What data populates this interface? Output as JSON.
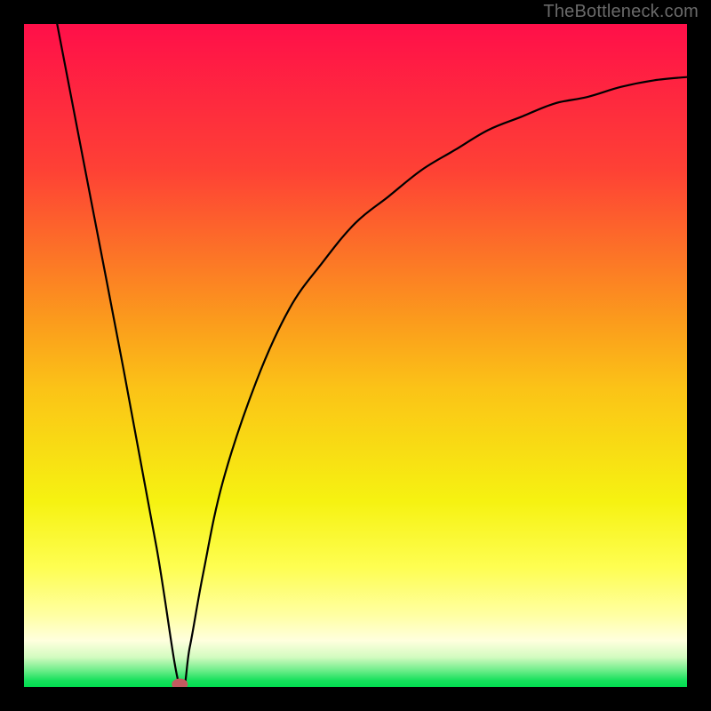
{
  "watermark": "TheBottleneck.com",
  "chart_data": {
    "type": "line",
    "title": "",
    "xlabel": "",
    "ylabel": "",
    "xlim": [
      0,
      100
    ],
    "ylim": [
      0,
      100
    ],
    "x": [
      5,
      10,
      15,
      20,
      23.5,
      25,
      27,
      30,
      35,
      40,
      45,
      50,
      55,
      60,
      65,
      70,
      75,
      80,
      85,
      90,
      95,
      100
    ],
    "values": [
      100,
      74,
      48,
      21,
      0,
      6,
      17,
      31,
      46,
      57,
      64,
      70,
      74,
      78,
      81,
      84,
      86,
      88,
      89,
      90.5,
      91.5,
      92
    ],
    "marker": {
      "x": 23.5,
      "y": 0
    },
    "background_gradient": {
      "stops": [
        {
          "offset": 0.0,
          "color": "#ff0f49"
        },
        {
          "offset": 0.22,
          "color": "#fe4135"
        },
        {
          "offset": 0.45,
          "color": "#fb9c1c"
        },
        {
          "offset": 0.55,
          "color": "#fbc317"
        },
        {
          "offset": 0.72,
          "color": "#f6f211"
        },
        {
          "offset": 0.82,
          "color": "#fefe52"
        },
        {
          "offset": 0.89,
          "color": "#ffffa1"
        },
        {
          "offset": 0.93,
          "color": "#ffffde"
        },
        {
          "offset": 0.955,
          "color": "#d3fbc0"
        },
        {
          "offset": 0.975,
          "color": "#6ded8a"
        },
        {
          "offset": 0.99,
          "color": "#17e15d"
        },
        {
          "offset": 1.0,
          "color": "#00dd4f"
        }
      ]
    }
  }
}
